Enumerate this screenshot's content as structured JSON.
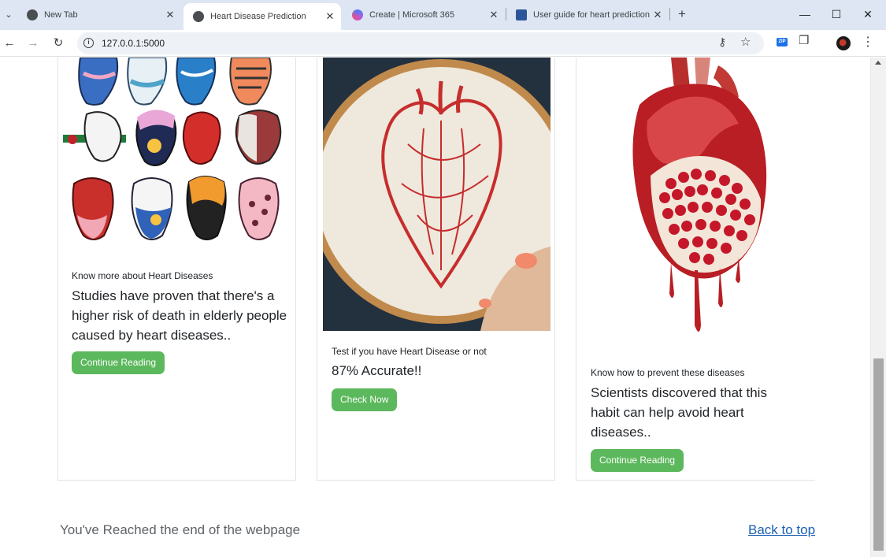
{
  "browser": {
    "tabs": [
      {
        "title": "New Tab",
        "active": false
      },
      {
        "title": "Heart Disease Prediction",
        "active": true
      },
      {
        "title": "Create | Microsoft 365",
        "active": false
      },
      {
        "title": "User guide for heart prediction",
        "active": false
      }
    ],
    "url": "127.0.0.1:5000"
  },
  "cards": [
    {
      "image": "heart-pins-collage-image",
      "label": "Know more about Heart Diseases",
      "title": "Studies have proven that there's a higher risk of death in elderly people caused by heart diseases..",
      "button": "Continue Reading"
    },
    {
      "image": "embroidered-heart-hoop-image",
      "label": "Test if you have Heart Disease or not",
      "title": "87% Accurate!!",
      "button": "Check Now"
    },
    {
      "image": "pomegranate-heart-image",
      "label": "Know how to prevent these diseases",
      "title": "Scientists discovered that this habit can help avoid heart diseases..",
      "button": "Continue Reading"
    }
  ],
  "footer": {
    "end_text": "You've Reached the end of the webpage",
    "back_to_top": "Back to top"
  },
  "colors": {
    "button": "#5cb85c",
    "link": "#1a5fb4",
    "tabstrip": "#dee6f3"
  }
}
